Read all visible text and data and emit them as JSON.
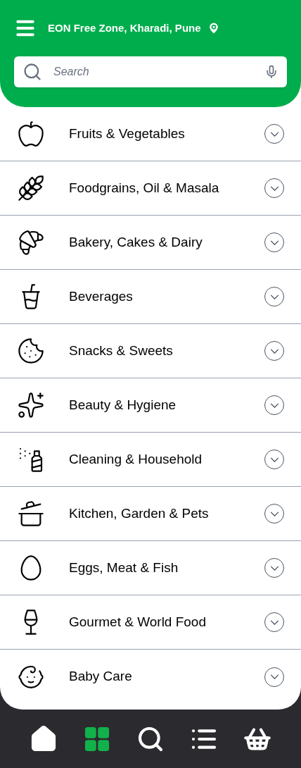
{
  "header": {
    "location": "EON Free Zone, Kharadi, Pune"
  },
  "search": {
    "placeholder": "Search"
  },
  "categories": [
    {
      "label": "Fruits & Vegetables",
      "expanded": false
    },
    {
      "label": "Foodgrains, Oil & Masala",
      "expanded": false
    },
    {
      "label": "Bakery, Cakes & Dairy",
      "expanded": false
    },
    {
      "label": "Beverages",
      "expanded": false
    },
    {
      "label": "Snacks & Sweets",
      "expanded": false
    },
    {
      "label": "Beauty & Hygiene",
      "expanded": false
    },
    {
      "label": "Cleaning & Household",
      "expanded": false
    },
    {
      "label": "Kitchen, Garden & Pets",
      "expanded": false
    },
    {
      "label": "Eggs, Meat & Fish",
      "expanded": false
    },
    {
      "label": "Gourmet & World Food",
      "expanded": false
    },
    {
      "label": "Baby Care",
      "expanded": false
    }
  ],
  "nav": [
    {
      "selected": false
    },
    {
      "selected": true
    },
    {
      "selected": false
    },
    {
      "selected": false
    },
    {
      "selected": false
    }
  ]
}
